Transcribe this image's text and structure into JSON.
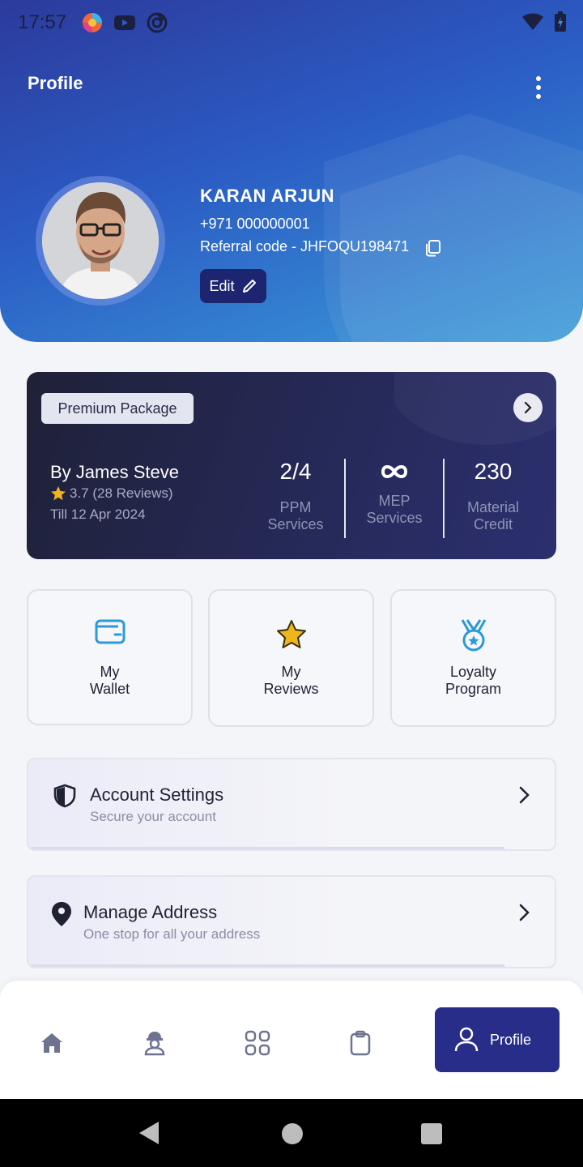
{
  "status_bar": {
    "time": "17:57"
  },
  "header": {
    "title": "Profile",
    "name": "KARAN ARJUN",
    "phone": "+971 000000001",
    "referral": "Referral code - JHFOQU198471",
    "edit_label": "Edit"
  },
  "package": {
    "badge": "Premium Package",
    "by": "By James Steve",
    "rating": "3.7 (28 Reviews)",
    "till": "Till 12 Apr 2024",
    "stats": [
      {
        "value": "2/4",
        "label_line1": "PPM",
        "label_line2": "Services"
      },
      {
        "value": "∞",
        "label_line1": "MEP",
        "label_line2": "Services"
      },
      {
        "value": "230",
        "label_line1": "Material",
        "label_line2": "Credit"
      }
    ]
  },
  "quick_actions": [
    {
      "line1": "My",
      "line2": "Wallet",
      "icon": "wallet-icon"
    },
    {
      "line1": "My",
      "line2": "Reviews",
      "icon": "star-icon"
    },
    {
      "line1": "Loyalty",
      "line2": "Program",
      "icon": "medal-icon"
    }
  ],
  "menu": [
    {
      "title": "Account Settings",
      "subtitle": "Secure your account",
      "icon": "shield-icon"
    },
    {
      "title": "Manage Address",
      "subtitle": "One stop for all your address",
      "icon": "location-pin-icon"
    }
  ],
  "bottom_nav": {
    "items": [
      "home-icon",
      "worker-icon",
      "grid-icon",
      "clipboard-icon"
    ],
    "active_label": "Profile"
  },
  "colors": {
    "header_start": "#2c3a9c",
    "header_end": "#3a9ad9",
    "package_bg": "#262a5a",
    "nav_active": "#282d8a",
    "icon_blue": "#2a9ad8",
    "star_gold": "#f1b51c"
  }
}
